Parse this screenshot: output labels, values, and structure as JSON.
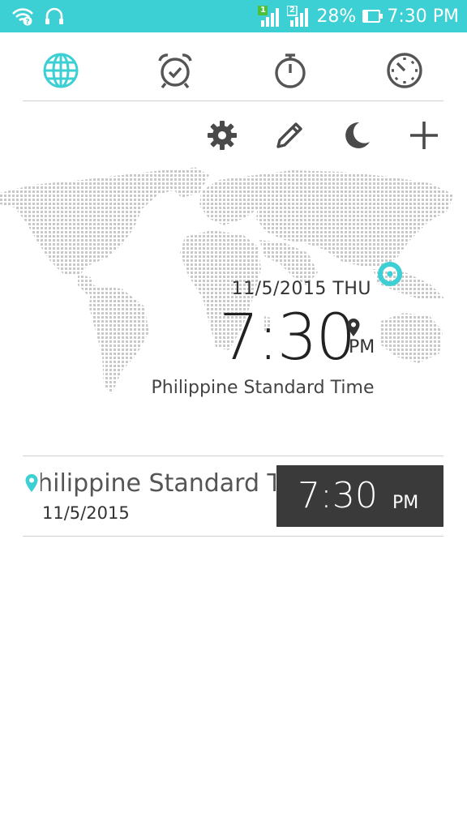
{
  "status_bar": {
    "sim1": "1",
    "sim2": "2",
    "battery_percent_text": "28%",
    "battery_level": 0.28,
    "clock": "7:30 PM",
    "bg_color": "#3ccfd3"
  },
  "tabs": [
    {
      "icon": "globe-icon",
      "selected": true
    },
    {
      "icon": "alarm-icon",
      "selected": false
    },
    {
      "icon": "stopwatch-icon",
      "selected": false
    },
    {
      "icon": "timer-icon",
      "selected": false
    }
  ],
  "actions": [
    "settings-icon",
    "edit-icon",
    "night-mode-icon",
    "add-icon"
  ],
  "hero": {
    "date": "11/5/2015 THU",
    "time": "7:30",
    "ampm": "PM",
    "zone": "Philippine Standard Time"
  },
  "cities": [
    {
      "name": "Philippine Standard Time",
      "date": "11/5/2015",
      "time": "7:30",
      "ampm": "PM"
    }
  ],
  "colors": {
    "accent": "#3ccfd3",
    "icon_gray": "#555555",
    "time_box": "#3a3a3a"
  }
}
